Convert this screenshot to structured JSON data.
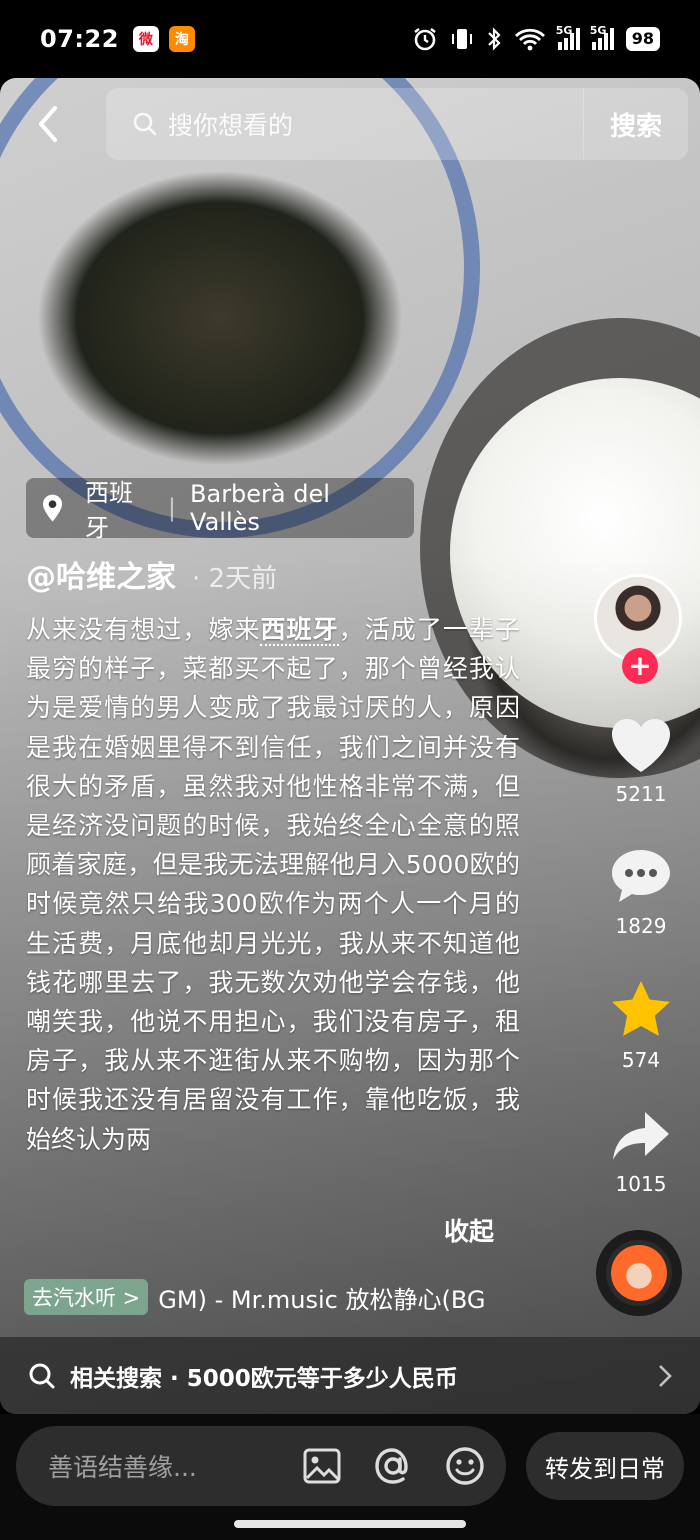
{
  "status_bar": {
    "time": "07:22",
    "apps": [
      "weibo-icon",
      "taobao-icon"
    ],
    "network_1": "5G",
    "network_2": "5G",
    "battery": "98"
  },
  "search": {
    "placeholder": "搜你想看的",
    "button": "搜索"
  },
  "location": {
    "country": "西班牙",
    "city": "Barberà del Vallès"
  },
  "post": {
    "author": "@哈维之家",
    "time_ago": "· 2天前",
    "description_before": "从来没有想过，嫁来",
    "description_highlight": "西班牙",
    "description_after": "，活成了一辈子最穷的样子，菜都买不起了，那个曾经我认为是爱情的男人变成了我最讨厌的人，原因是我在婚姻里得不到信任，我们之间并没有很大的矛盾，虽然我对他性格非常不满，但是经济没问题的时候，我始终全心全意的照顾着家庭，但是我无法理解他月入5000欧的时候竟然只给我300欧作为两个人一个月的生活费，月底他却月光光，我从来不知道他钱花哪里去了，我无数次劝他学会存钱，他嘲笑我，他说不用担心，我们没有房子，租房子，我从来不逛街从来不购物，因为那个时候我还没有居留没有工作，靠他吃饭，我始终认为两",
    "collapse": "收起"
  },
  "music": {
    "badge": "去汽水听 >",
    "title": "GM) - Mr.music    放松静心(BG"
  },
  "actions": {
    "follow": "+",
    "likes": "5211",
    "comments": "1829",
    "favorites": "574",
    "shares": "1015"
  },
  "colors": {
    "follow_red": "#fe2c55",
    "star_yellow": "#ffc300",
    "music_badge": "#82b296"
  },
  "related": {
    "label": "相关搜索 · 5000欧元等于多少人民币"
  },
  "comment": {
    "placeholder": "善语结善缘...",
    "forward": "转发到日常"
  }
}
